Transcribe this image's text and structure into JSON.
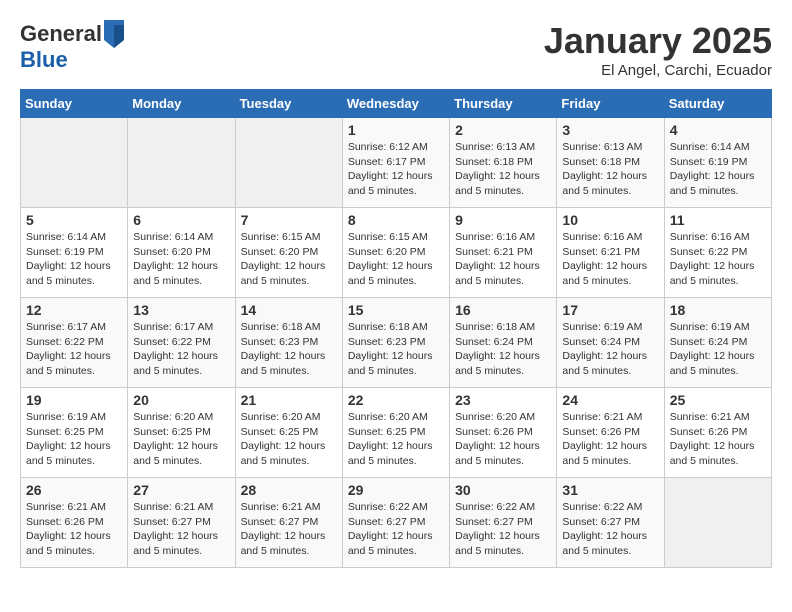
{
  "header": {
    "logo_general": "General",
    "logo_blue": "Blue",
    "month_title": "January 2025",
    "subtitle": "El Angel, Carchi, Ecuador"
  },
  "days_of_week": [
    "Sunday",
    "Monday",
    "Tuesday",
    "Wednesday",
    "Thursday",
    "Friday",
    "Saturday"
  ],
  "weeks": [
    [
      {
        "day": "",
        "info": ""
      },
      {
        "day": "",
        "info": ""
      },
      {
        "day": "",
        "info": ""
      },
      {
        "day": "1",
        "sunrise": "6:12 AM",
        "sunset": "6:17 PM",
        "daylight": "12 hours and 5 minutes."
      },
      {
        "day": "2",
        "sunrise": "6:13 AM",
        "sunset": "6:18 PM",
        "daylight": "12 hours and 5 minutes."
      },
      {
        "day": "3",
        "sunrise": "6:13 AM",
        "sunset": "6:18 PM",
        "daylight": "12 hours and 5 minutes."
      },
      {
        "day": "4",
        "sunrise": "6:14 AM",
        "sunset": "6:19 PM",
        "daylight": "12 hours and 5 minutes."
      }
    ],
    [
      {
        "day": "5",
        "sunrise": "6:14 AM",
        "sunset": "6:19 PM",
        "daylight": "12 hours and 5 minutes."
      },
      {
        "day": "6",
        "sunrise": "6:14 AM",
        "sunset": "6:20 PM",
        "daylight": "12 hours and 5 minutes."
      },
      {
        "day": "7",
        "sunrise": "6:15 AM",
        "sunset": "6:20 PM",
        "daylight": "12 hours and 5 minutes."
      },
      {
        "day": "8",
        "sunrise": "6:15 AM",
        "sunset": "6:20 PM",
        "daylight": "12 hours and 5 minutes."
      },
      {
        "day": "9",
        "sunrise": "6:16 AM",
        "sunset": "6:21 PM",
        "daylight": "12 hours and 5 minutes."
      },
      {
        "day": "10",
        "sunrise": "6:16 AM",
        "sunset": "6:21 PM",
        "daylight": "12 hours and 5 minutes."
      },
      {
        "day": "11",
        "sunrise": "6:16 AM",
        "sunset": "6:22 PM",
        "daylight": "12 hours and 5 minutes."
      }
    ],
    [
      {
        "day": "12",
        "sunrise": "6:17 AM",
        "sunset": "6:22 PM",
        "daylight": "12 hours and 5 minutes."
      },
      {
        "day": "13",
        "sunrise": "6:17 AM",
        "sunset": "6:22 PM",
        "daylight": "12 hours and 5 minutes."
      },
      {
        "day": "14",
        "sunrise": "6:18 AM",
        "sunset": "6:23 PM",
        "daylight": "12 hours and 5 minutes."
      },
      {
        "day": "15",
        "sunrise": "6:18 AM",
        "sunset": "6:23 PM",
        "daylight": "12 hours and 5 minutes."
      },
      {
        "day": "16",
        "sunrise": "6:18 AM",
        "sunset": "6:24 PM",
        "daylight": "12 hours and 5 minutes."
      },
      {
        "day": "17",
        "sunrise": "6:19 AM",
        "sunset": "6:24 PM",
        "daylight": "12 hours and 5 minutes."
      },
      {
        "day": "18",
        "sunrise": "6:19 AM",
        "sunset": "6:24 PM",
        "daylight": "12 hours and 5 minutes."
      }
    ],
    [
      {
        "day": "19",
        "sunrise": "6:19 AM",
        "sunset": "6:25 PM",
        "daylight": "12 hours and 5 minutes."
      },
      {
        "day": "20",
        "sunrise": "6:20 AM",
        "sunset": "6:25 PM",
        "daylight": "12 hours and 5 minutes."
      },
      {
        "day": "21",
        "sunrise": "6:20 AM",
        "sunset": "6:25 PM",
        "daylight": "12 hours and 5 minutes."
      },
      {
        "day": "22",
        "sunrise": "6:20 AM",
        "sunset": "6:25 PM",
        "daylight": "12 hours and 5 minutes."
      },
      {
        "day": "23",
        "sunrise": "6:20 AM",
        "sunset": "6:26 PM",
        "daylight": "12 hours and 5 minutes."
      },
      {
        "day": "24",
        "sunrise": "6:21 AM",
        "sunset": "6:26 PM",
        "daylight": "12 hours and 5 minutes."
      },
      {
        "day": "25",
        "sunrise": "6:21 AM",
        "sunset": "6:26 PM",
        "daylight": "12 hours and 5 minutes."
      }
    ],
    [
      {
        "day": "26",
        "sunrise": "6:21 AM",
        "sunset": "6:26 PM",
        "daylight": "12 hours and 5 minutes."
      },
      {
        "day": "27",
        "sunrise": "6:21 AM",
        "sunset": "6:27 PM",
        "daylight": "12 hours and 5 minutes."
      },
      {
        "day": "28",
        "sunrise": "6:21 AM",
        "sunset": "6:27 PM",
        "daylight": "12 hours and 5 minutes."
      },
      {
        "day": "29",
        "sunrise": "6:22 AM",
        "sunset": "6:27 PM",
        "daylight": "12 hours and 5 minutes."
      },
      {
        "day": "30",
        "sunrise": "6:22 AM",
        "sunset": "6:27 PM",
        "daylight": "12 hours and 5 minutes."
      },
      {
        "day": "31",
        "sunrise": "6:22 AM",
        "sunset": "6:27 PM",
        "daylight": "12 hours and 5 minutes."
      },
      {
        "day": "",
        "info": ""
      }
    ]
  ],
  "labels": {
    "sunrise": "Sunrise:",
    "sunset": "Sunset:",
    "daylight": "Daylight:"
  }
}
